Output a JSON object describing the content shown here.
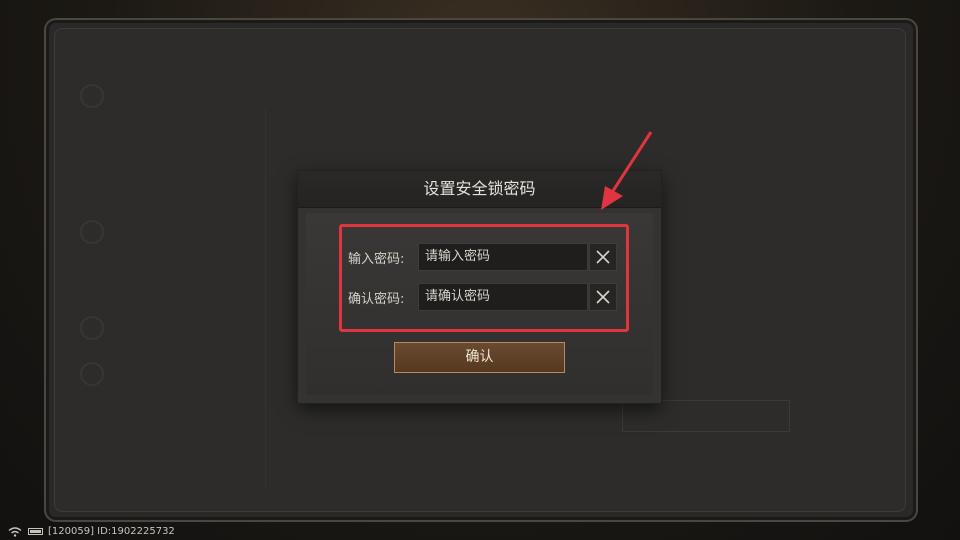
{
  "modal": {
    "title": "设置安全锁密码",
    "password_label": "输入密码:",
    "password_placeholder": "请输入密码",
    "confirm_label": "确认密码:",
    "confirm_placeholder": "请确认密码",
    "confirm_button": "确认"
  },
  "status_bar": {
    "info": "[120059] ID:1902225732"
  },
  "colors": {
    "highlight": "#e0343e",
    "confirm_border": "#b8895b",
    "confirm_fill": "#5e4128"
  },
  "icons": {
    "clear": "close-icon",
    "pointer": "arrow-icon",
    "wifi": "wifi-icon",
    "battery": "battery-icon"
  }
}
